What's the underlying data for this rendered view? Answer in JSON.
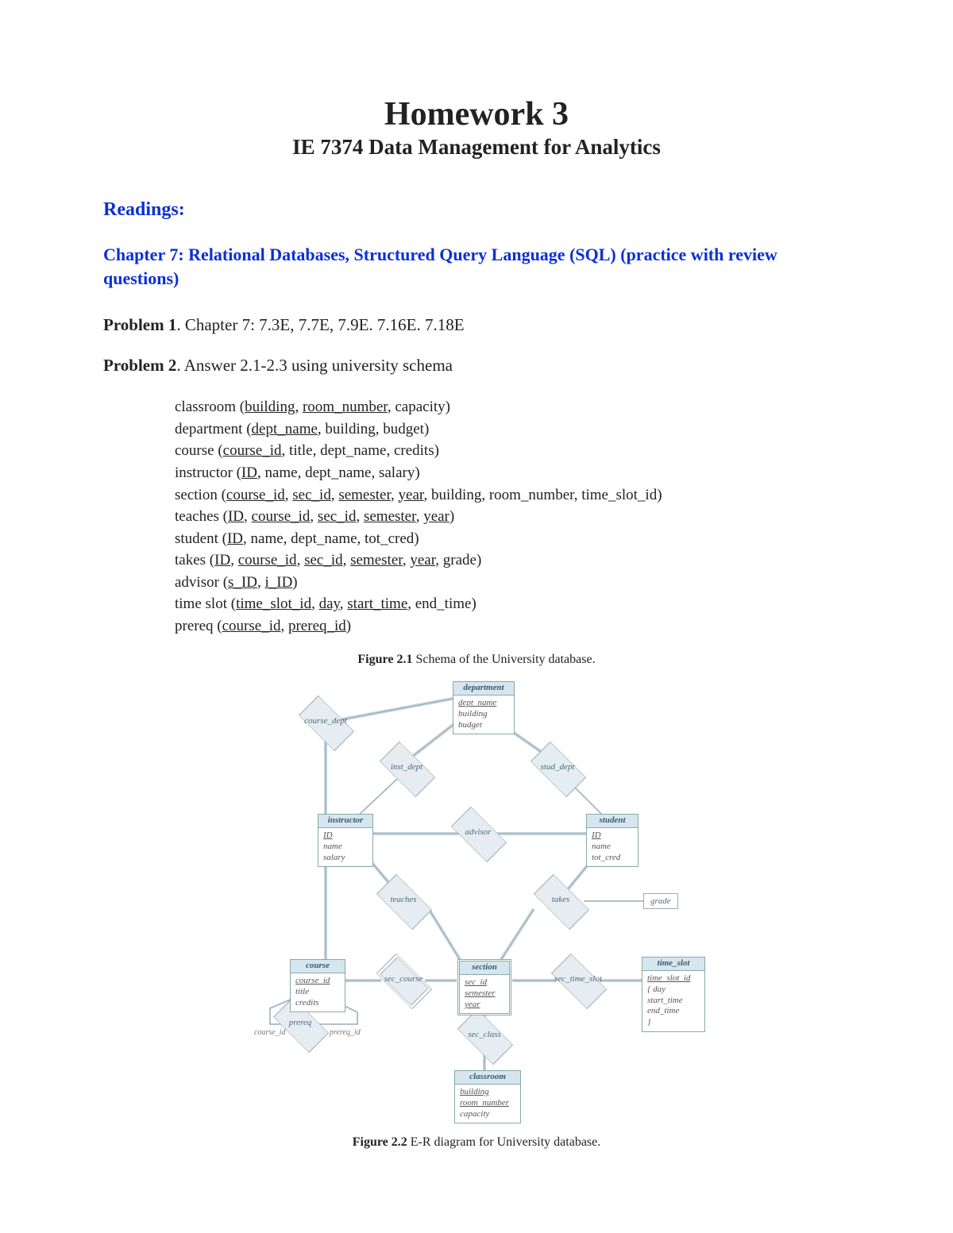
{
  "title": "Homework 3",
  "subtitle": "IE 7374 Data Management for Analytics",
  "readings_label": "Readings:",
  "chapter_line": "Chapter 7: Relational Databases, Structured Query Language (SQL) (practice with review questions)",
  "problem1_label": "Problem 1",
  "problem1_text": ". Chapter 7: 7.3E, 7.7E, 7.9E. 7.16E. 7.18E",
  "problem2_label": "Problem 2",
  "problem2_text": ". Answer 2.1-2.3 using university schema",
  "schema": {
    "classroom": {
      "rel": "classroom",
      "pk": [
        "building",
        "room_number"
      ],
      "rest": ", capacity)"
    },
    "department": {
      "rel": "department",
      "pk": [
        "dept_name"
      ],
      "rest": ", building, budget)"
    },
    "course": {
      "rel": "course",
      "pk": [
        "course_id"
      ],
      "rest": ", title, dept_name, credits)"
    },
    "instructor": {
      "rel": "instructor",
      "pk": [
        "ID"
      ],
      "rest": ", name, dept_name, salary)"
    },
    "section": {
      "rel": "section",
      "pk": [
        "course_id",
        "sec_id",
        "semester",
        "year"
      ],
      "rest": ", building, room_number, time_slot_id)"
    },
    "teaches": {
      "rel": "teaches",
      "pk": [
        "ID",
        "course_id",
        "sec_id",
        "semester",
        "year"
      ],
      "rest": ")"
    },
    "student": {
      "rel": "student",
      "pk": [
        "ID"
      ],
      "rest": ", name, dept_name, tot_cred)"
    },
    "takes": {
      "rel": "takes",
      "pk": [
        "ID",
        "course_id",
        "sec_id",
        "semester",
        "year"
      ],
      "rest": ", grade)"
    },
    "advisor": {
      "rel": "advisor",
      "pk": [
        "s_ID",
        "i_ID"
      ],
      "rest": ")"
    },
    "time_slot": {
      "rel": "time slot",
      "pk": [
        "time_slot_id",
        "day",
        "start_time"
      ],
      "rest": ", end_time)"
    },
    "prereq": {
      "rel": "prereq",
      "pk": [
        "course_id",
        "prereq_id"
      ],
      "rest": ")"
    }
  },
  "figure21_caption_bold": "Figure 2.1",
  "figure21_caption_rest": " Schema of the University database.",
  "figure22_caption_bold": "Figure 2.2",
  "figure22_caption_rest": " E-R diagram for University database.",
  "er": {
    "entities": {
      "department": {
        "name": "department",
        "attrs": [
          [
            "dept_name",
            true
          ],
          [
            "building",
            false
          ],
          [
            "budget",
            false
          ]
        ]
      },
      "instructor": {
        "name": "instructor",
        "attrs": [
          [
            "ID",
            true
          ],
          [
            "name",
            false
          ],
          [
            "salary",
            false
          ]
        ]
      },
      "student": {
        "name": "student",
        "attrs": [
          [
            "ID",
            true
          ],
          [
            "name",
            false
          ],
          [
            "tot_cred",
            false
          ]
        ]
      },
      "course": {
        "name": "course",
        "attrs": [
          [
            "course_id",
            true
          ],
          [
            "title",
            false
          ],
          [
            "credits",
            false
          ]
        ]
      },
      "section": {
        "name": "section",
        "attrs": [
          [
            "sec_id",
            true
          ],
          [
            "semester",
            true
          ],
          [
            "year",
            true
          ]
        ]
      },
      "time_slot": {
        "name": "time_slot",
        "attrs": [
          [
            "time_slot_id",
            true
          ],
          [
            "{ day",
            false
          ],
          [
            "  start_time",
            false
          ],
          [
            "  end_time",
            false
          ],
          [
            "}",
            false
          ]
        ]
      },
      "classroom": {
        "name": "classroom",
        "attrs": [
          [
            "building",
            true
          ],
          [
            "room_number",
            true
          ],
          [
            "capacity",
            false
          ]
        ]
      }
    },
    "relationships": {
      "course_dept": "course_dept",
      "inst_dept": "inst_dept",
      "stud_dept": "stud_dept",
      "advisor": "advisor",
      "teaches": "teaches",
      "takes": "takes",
      "sec_course": "sec_course",
      "sec_time_slot": "sec_time_slot",
      "sec_class": "sec_class",
      "prereq": "prereq"
    },
    "attr_grade": "grade",
    "labels": {
      "course_id": "course_id",
      "prereq_id": "prereq_id"
    }
  }
}
